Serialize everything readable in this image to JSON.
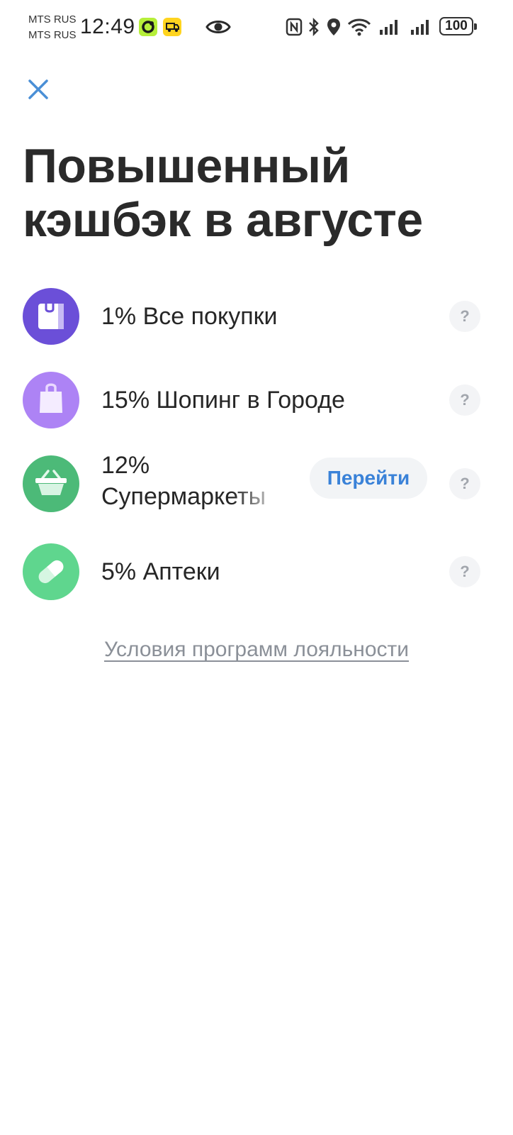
{
  "status_bar": {
    "carrier_1": "MTS RUS",
    "carrier_2": "MTS RUS",
    "time": "12:49",
    "battery": "100",
    "icons": [
      "nfc-icon",
      "bluetooth-icon",
      "location-icon",
      "wifi-icon",
      "signal-icon",
      "signal-icon"
    ]
  },
  "header": {
    "close_icon": "close-icon"
  },
  "page": {
    "title": "Повышенный кэшбэк в августе"
  },
  "cashback": {
    "items": [
      {
        "label": "1% Все покупки",
        "icon": "shopping-bag-icon",
        "color": "#6b4fd8"
      },
      {
        "label": "15% Шопинг в Городе",
        "icon": "tote-bag-icon",
        "color": "#ad83f5"
      },
      {
        "label": "12% Супермаркеты",
        "icon": "basket-icon",
        "color": "#4cba78",
        "action": "Перейти"
      },
      {
        "label": "5% Аптеки",
        "icon": "pill-icon",
        "color": "#5fd68e"
      }
    ],
    "help_label": "?"
  },
  "footer": {
    "terms_link": "Условия программ лояльности"
  },
  "colors": {
    "accent": "#3a82d8",
    "close": "#4a8fd6",
    "muted": "#8b9098"
  }
}
